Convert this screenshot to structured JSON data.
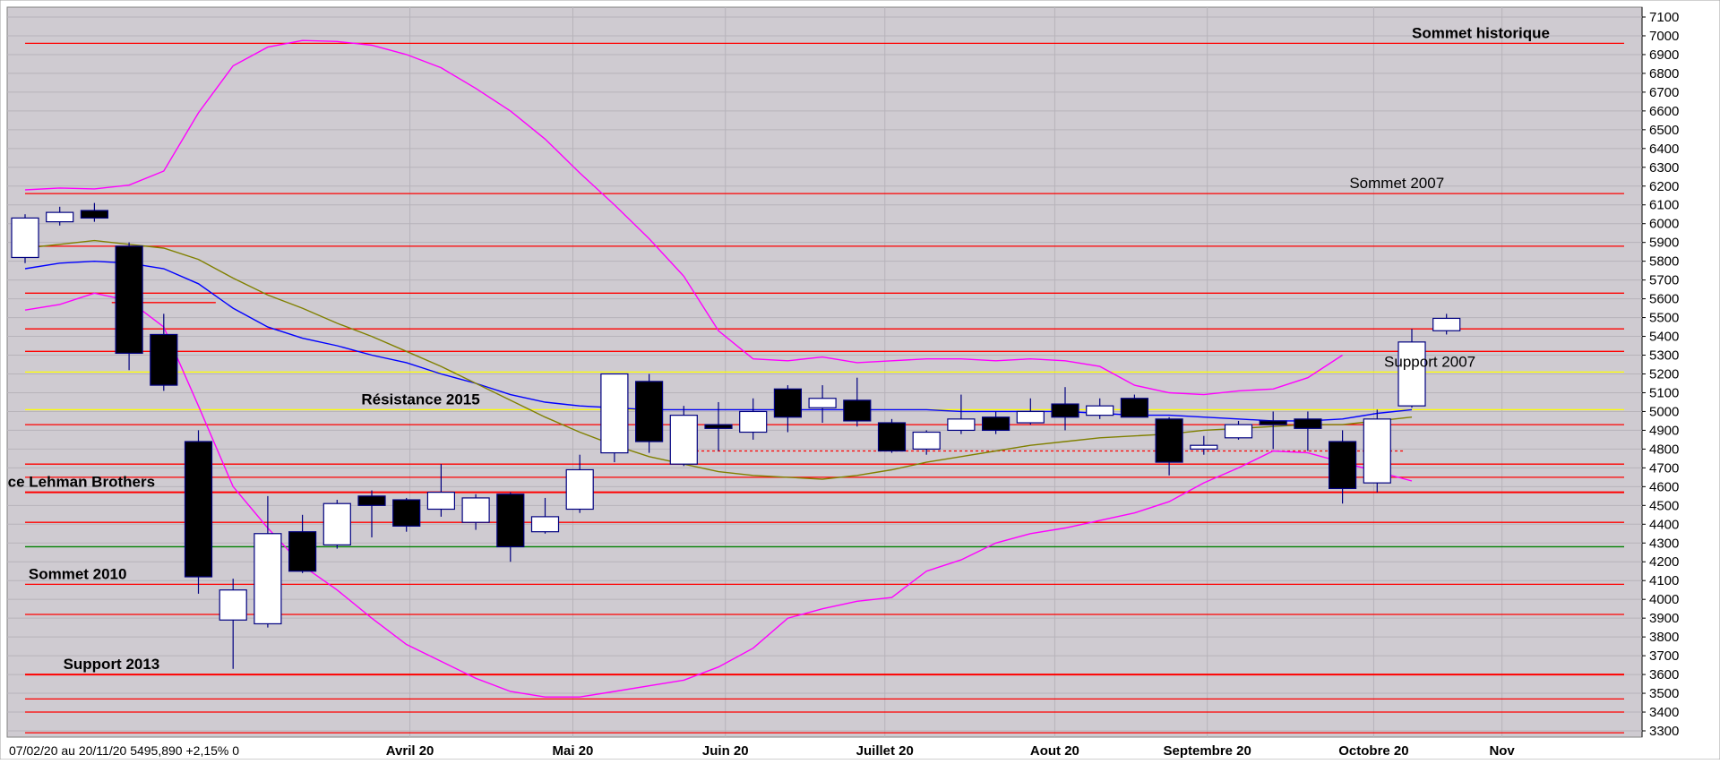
{
  "chart_data": {
    "type": "candlestick",
    "title": "",
    "background_color": "#cfcbd1",
    "grid": true,
    "y_axis": {
      "position": "right",
      "ylim": [
        3250,
        7150
      ],
      "ticks": [
        3300,
        3400,
        3500,
        3600,
        3700,
        3800,
        3900,
        4000,
        4100,
        4200,
        4300,
        4400,
        4500,
        4600,
        4700,
        4800,
        4900,
        5000,
        5100,
        5200,
        5300,
        5400,
        5500,
        5600,
        5700,
        5800,
        5900,
        6000,
        6100,
        6200,
        6300,
        6400,
        6500,
        6600,
        6700,
        6800,
        6900,
        7000,
        7100
      ]
    },
    "x_axis": {
      "labels": [
        {
          "text": "Avril 20",
          "week": 11.1
        },
        {
          "text": "Mai 20",
          "week": 15.8
        },
        {
          "text": "Juin 20",
          "week": 20.2
        },
        {
          "text": "Juillet 20",
          "week": 24.8
        },
        {
          "text": "Aout 20",
          "week": 29.7
        },
        {
          "text": "Septembre 20",
          "week": 34.1
        },
        {
          "text": "Octobre 20",
          "week": 38.9
        },
        {
          "text": "Nov",
          "week": 42.6
        }
      ]
    },
    "info_text": "07/02/20 au 20/11/20  5495,890  +2,15%  0",
    "candles": [
      {
        "date": "07/02/20",
        "o": 5820,
        "h": 6050,
        "l": 5790,
        "c": 6030
      },
      {
        "date": "14/02/20",
        "o": 6010,
        "h": 6090,
        "l": 5990,
        "c": 6060
      },
      {
        "date": "21/02/20",
        "o": 6070,
        "h": 6110,
        "l": 6010,
        "c": 6030
      },
      {
        "date": "28/02/20",
        "o": 5880,
        "h": 5900,
        "l": 5220,
        "c": 5310
      },
      {
        "date": "06/03/20",
        "o": 5410,
        "h": 5520,
        "l": 5110,
        "c": 5140
      },
      {
        "date": "13/03/20",
        "o": 4840,
        "h": 4900,
        "l": 4030,
        "c": 4120
      },
      {
        "date": "20/03/20",
        "o": 3890,
        "h": 4110,
        "l": 3630,
        "c": 4050
      },
      {
        "date": "27/03/20",
        "o": 3870,
        "h": 4550,
        "l": 3850,
        "c": 4350
      },
      {
        "date": "03/04/20",
        "o": 4360,
        "h": 4450,
        "l": 4140,
        "c": 4150
      },
      {
        "date": "10/04/20",
        "o": 4290,
        "h": 4530,
        "l": 4270,
        "c": 4510
      },
      {
        "date": "17/04/20",
        "o": 4550,
        "h": 4580,
        "l": 4330,
        "c": 4500
      },
      {
        "date": "24/04/20",
        "o": 4530,
        "h": 4540,
        "l": 4360,
        "c": 4390
      },
      {
        "date": "01/05/20",
        "o": 4480,
        "h": 4720,
        "l": 4440,
        "c": 4570
      },
      {
        "date": "08/05/20",
        "o": 4410,
        "h": 4560,
        "l": 4370,
        "c": 4540
      },
      {
        "date": "15/05/20",
        "o": 4560,
        "h": 4570,
        "l": 4200,
        "c": 4280
      },
      {
        "date": "22/05/20",
        "o": 4360,
        "h": 4540,
        "l": 4350,
        "c": 4440
      },
      {
        "date": "29/05/20",
        "o": 4480,
        "h": 4770,
        "l": 4460,
        "c": 4690
      },
      {
        "date": "05/06/20",
        "o": 4780,
        "h": 5200,
        "l": 4730,
        "c": 5200
      },
      {
        "date": "12/06/20",
        "o": 5160,
        "h": 5200,
        "l": 4780,
        "c": 4840
      },
      {
        "date": "19/06/20",
        "o": 4720,
        "h": 5030,
        "l": 4710,
        "c": 4980
      },
      {
        "date": "26/06/20",
        "o": 4930,
        "h": 5050,
        "l": 4790,
        "c": 4910
      },
      {
        "date": "03/07/20",
        "o": 4890,
        "h": 5070,
        "l": 4850,
        "c": 5000
      },
      {
        "date": "10/07/20",
        "o": 5120,
        "h": 5140,
        "l": 4890,
        "c": 4970
      },
      {
        "date": "17/07/20",
        "o": 5020,
        "h": 5140,
        "l": 4940,
        "c": 5070
      },
      {
        "date": "24/07/20",
        "o": 5060,
        "h": 5180,
        "l": 4920,
        "c": 4950
      },
      {
        "date": "31/07/20",
        "o": 4940,
        "h": 4960,
        "l": 4780,
        "c": 4790
      },
      {
        "date": "07/08/20",
        "o": 4800,
        "h": 4900,
        "l": 4770,
        "c": 4890
      },
      {
        "date": "14/08/20",
        "o": 4900,
        "h": 5090,
        "l": 4880,
        "c": 4960
      },
      {
        "date": "21/08/20",
        "o": 4970,
        "h": 5000,
        "l": 4880,
        "c": 4900
      },
      {
        "date": "28/08/20",
        "o": 4940,
        "h": 5070,
        "l": 4930,
        "c": 5000
      },
      {
        "date": "04/09/20",
        "o": 5040,
        "h": 5130,
        "l": 4900,
        "c": 4970
      },
      {
        "date": "11/09/20",
        "o": 4980,
        "h": 5070,
        "l": 4960,
        "c": 5030
      },
      {
        "date": "18/09/20",
        "o": 5070,
        "h": 5090,
        "l": 4980,
        "c": 4970
      },
      {
        "date": "25/09/20",
        "o": 4960,
        "h": 4970,
        "l": 4660,
        "c": 4730
      },
      {
        "date": "02/10/20",
        "o": 4800,
        "h": 4870,
        "l": 4770,
        "c": 4820
      },
      {
        "date": "09/10/20",
        "o": 4860,
        "h": 4950,
        "l": 4850,
        "c": 4930
      },
      {
        "date": "16/10/20",
        "o": 4950,
        "h": 5000,
        "l": 4800,
        "c": 4930
      },
      {
        "date": "23/10/20",
        "o": 4960,
        "h": 5000,
        "l": 4790,
        "c": 4910
      },
      {
        "date": "30/10/20",
        "o": 4840,
        "h": 4900,
        "l": 4510,
        "c": 4590
      },
      {
        "date": "06/11/20",
        "o": 4620,
        "h": 5010,
        "l": 4570,
        "c": 4960
      },
      {
        "date": "13/11/20",
        "o": 5030,
        "h": 5440,
        "l": 5020,
        "c": 5370
      },
      {
        "date": "20/11/20",
        "o": 5430,
        "h": 5520,
        "l": 5410,
        "c": 5495.89
      }
    ],
    "horizontal_lines": [
      {
        "value": 6960,
        "color": "#ff0000",
        "label": "Sommet historique",
        "label_week": 40.0,
        "bold": true
      },
      {
        "value": 6160,
        "color": "#ff0000",
        "label": "Sommet 2007",
        "label_week": 38.2,
        "bold": false
      },
      {
        "value": 5880,
        "color": "#ff0000"
      },
      {
        "value": 5630,
        "color": "#ff0000"
      },
      {
        "value": 5440,
        "color": "#ff0000"
      },
      {
        "value": 5320,
        "color": "#ff0000"
      },
      {
        "value": 5210,
        "color": "#ffff00",
        "label": "Support 2007",
        "label_week": 39.2,
        "bold": false
      },
      {
        "value": 5010,
        "color": "#ffff00",
        "label": "Résistance 2015",
        "label_week": 9.7,
        "bold": true
      },
      {
        "value": 4930,
        "color": "#ff0000"
      },
      {
        "value": 4720,
        "color": "#ff0000"
      },
      {
        "value": 4650,
        "color": "#ff0000"
      },
      {
        "value": 4570,
        "color": "#ff0000",
        "label": "ce Lehman Brothers",
        "label_week": -0.5,
        "bold": true
      },
      {
        "value": 4410,
        "color": "#ff0000"
      },
      {
        "value": 4280,
        "color": "#008000"
      },
      {
        "value": 4080,
        "color": "#ff0000",
        "label": "Sommet 2010",
        "label_week": 0.1,
        "bold": true
      },
      {
        "value": 3920,
        "color": "#ff0000"
      },
      {
        "value": 3600,
        "color": "#ff0000",
        "label": "Support 2013",
        "label_week": 1.1,
        "bold": true
      },
      {
        "value": 3470,
        "color": "#ff0000"
      },
      {
        "value": 3400,
        "color": "#ff0000"
      },
      {
        "value": 3290,
        "color": "#ff0000"
      }
    ],
    "short_lines": [
      {
        "value": 5580,
        "from_week": 2.5,
        "to_week": 5.5,
        "color": "#ff0000",
        "dashed": false
      },
      {
        "value": 4790,
        "from_week": 19.2,
        "to_week": 39.8,
        "color": "#ff0000",
        "dashed": true
      }
    ],
    "series": [
      {
        "name": "",
        "color": "#ff00ff",
        "values": [
          6180,
          6190,
          6185,
          6205,
          6280,
          6590,
          6840,
          6940,
          6975,
          6970,
          6950,
          6900,
          6830,
          6720,
          6600,
          6450,
          6270,
          6100,
          5920,
          5720,
          5430,
          5280,
          5270,
          5290,
          5260,
          5270,
          5280,
          5280,
          5270,
          5280,
          5270,
          5240,
          5140,
          5100,
          5090,
          5110,
          5120,
          5180,
          5300,
          null,
          null,
          null
        ]
      },
      {
        "name": "",
        "color": "#ff00ff",
        "values": [
          5540,
          5570,
          5630,
          5590,
          5450,
          5030,
          4600,
          4380,
          4180,
          4050,
          3900,
          3760,
          3670,
          3580,
          3510,
          3480,
          3480,
          3510,
          3540,
          3570,
          3640,
          3740,
          3900,
          3950,
          3990,
          4010,
          4150,
          4210,
          4300,
          4350,
          4380,
          4420,
          4460,
          4520,
          4620,
          4700,
          4790,
          4780,
          4730,
          4680,
          4630,
          null
        ]
      },
      {
        "name": "",
        "color": "#0000ff",
        "values": [
          5760,
          5790,
          5800,
          5790,
          5760,
          5680,
          5550,
          5450,
          5390,
          5350,
          5300,
          5260,
          5200,
          5150,
          5090,
          5050,
          5030,
          5020,
          5010,
          5010,
          5010,
          5010,
          5010,
          5010,
          5010,
          5010,
          5010,
          5000,
          5000,
          5000,
          5000,
          4990,
          4980,
          4980,
          4970,
          4960,
          4950,
          4950,
          4960,
          4990,
          5010,
          null
        ]
      },
      {
        "name": "",
        "color": "#808000",
        "values": [
          5870,
          5890,
          5910,
          5890,
          5870,
          5810,
          5710,
          5620,
          5550,
          5470,
          5400,
          5320,
          5240,
          5150,
          5060,
          4970,
          4890,
          4820,
          4760,
          4720,
          4680,
          4660,
          4650,
          4640,
          4660,
          4690,
          4730,
          4760,
          4790,
          4820,
          4840,
          4860,
          4870,
          4880,
          4900,
          4910,
          4920,
          4930,
          4930,
          4950,
          4970,
          null
        ]
      }
    ]
  }
}
